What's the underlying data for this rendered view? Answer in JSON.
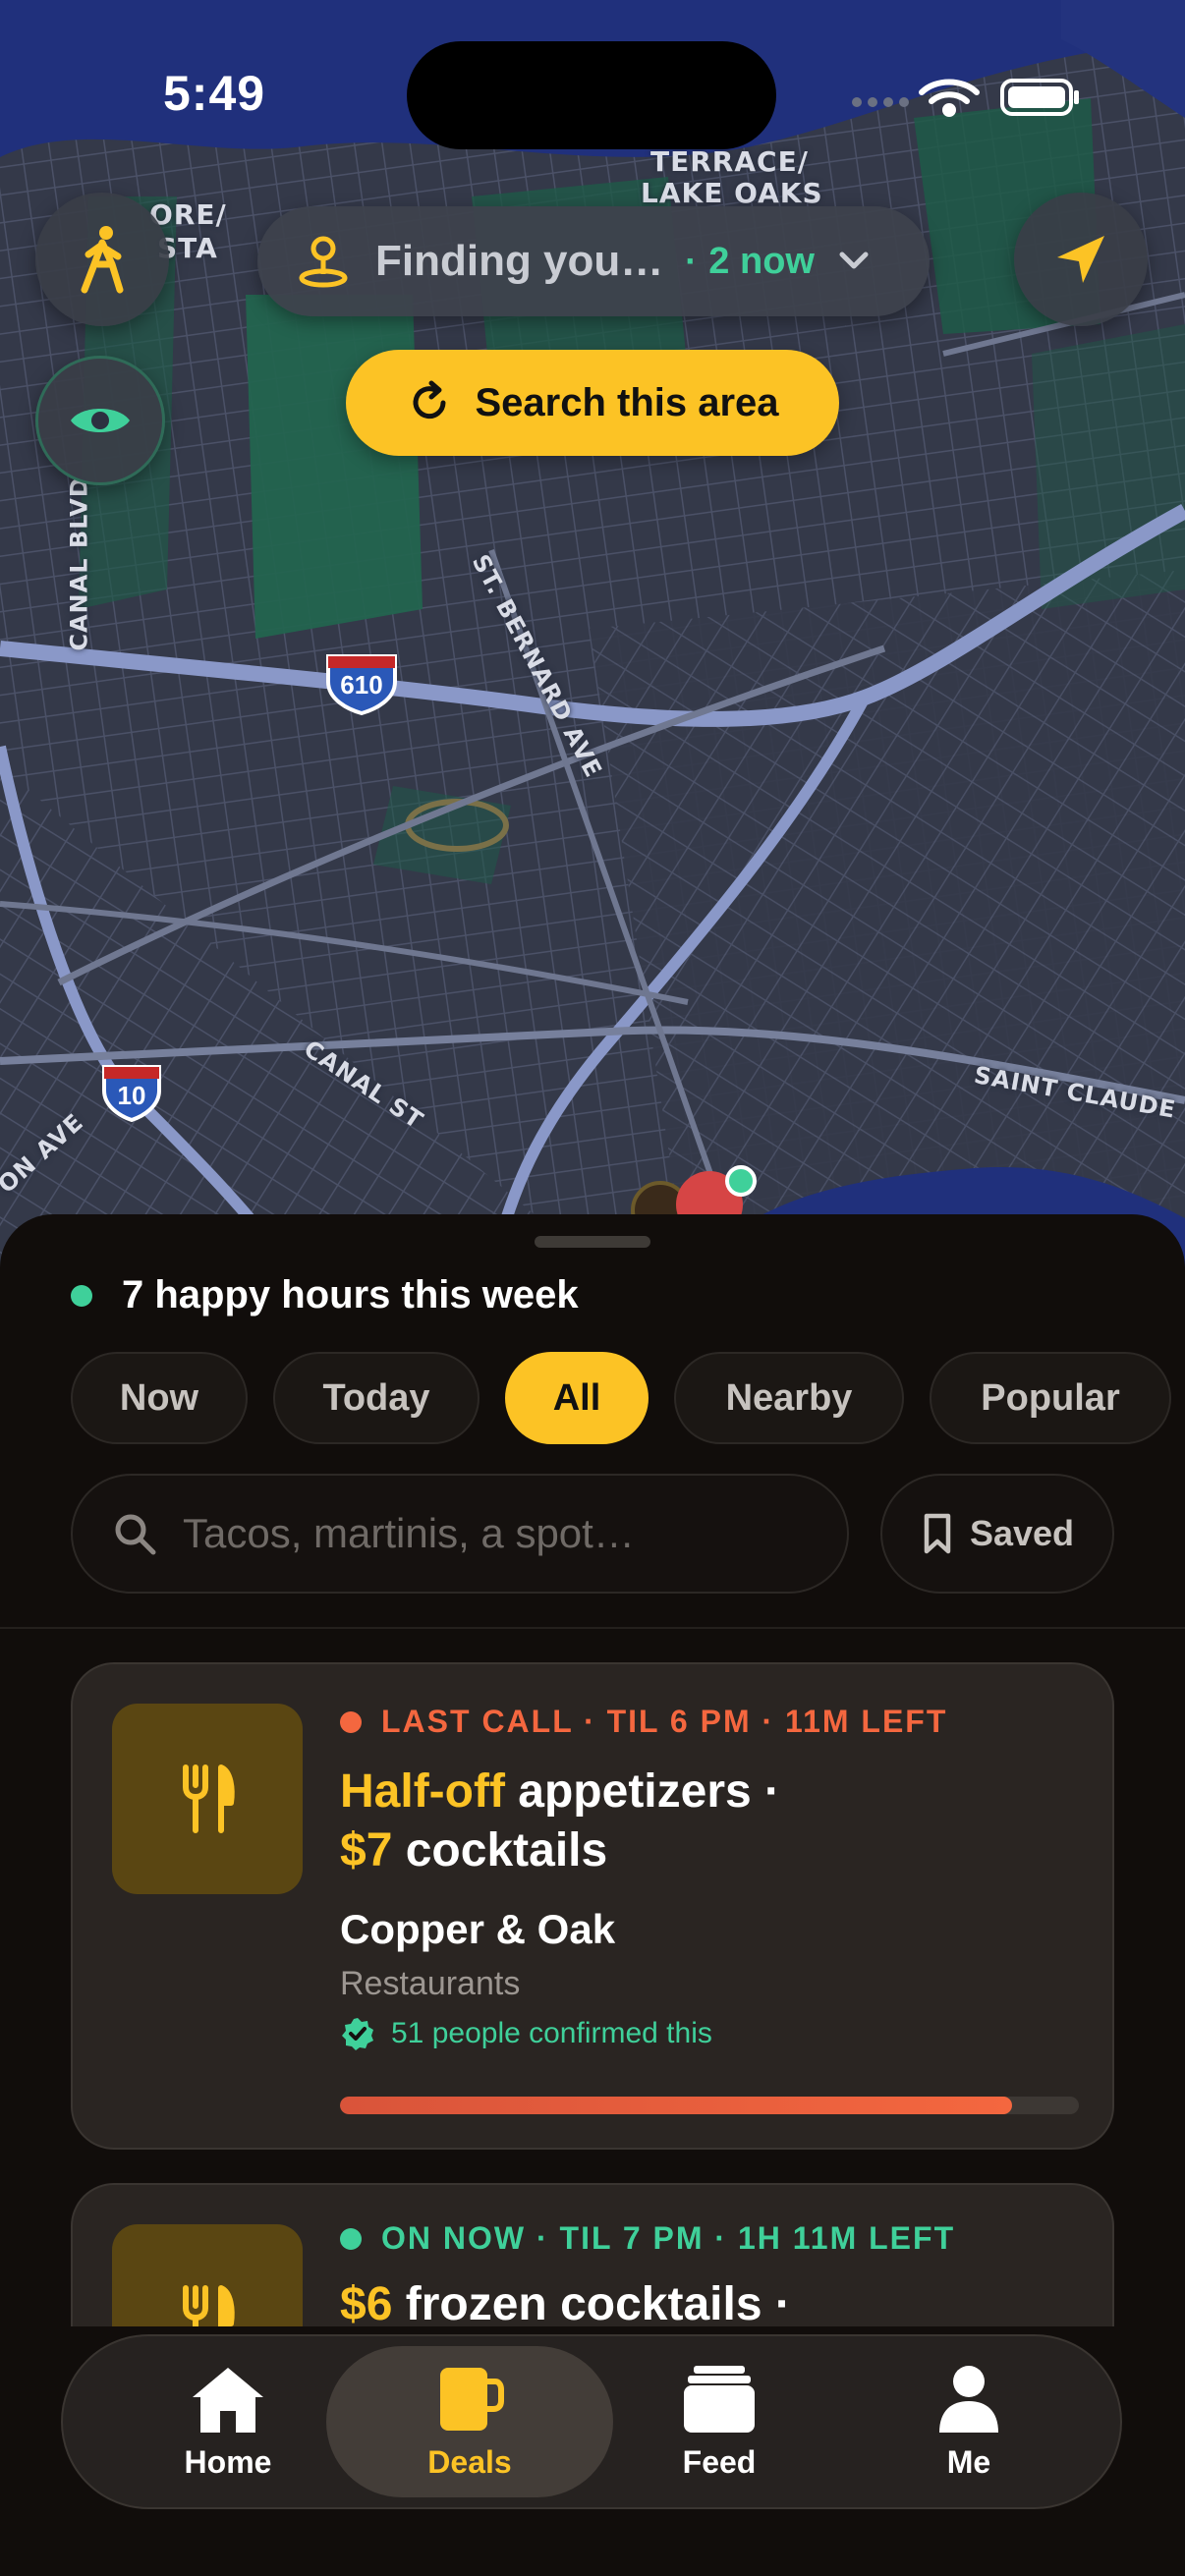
{
  "status_bar": {
    "time": "5:49"
  },
  "map": {
    "labels": {
      "terrace_1": "TERRACE/",
      "terrace_2": "LAKE OAKS",
      "ore_1": "ORE/",
      "ore_2": "STA",
      "canal_blvd": "CANAL BLVD",
      "st_bernard": "ST. BERNARD AVE",
      "canal_st": "CANAL ST",
      "saint_claude": "SAINT CLAUDE",
      "on_ave": "ON AVE"
    },
    "shields": {
      "i610": "610",
      "i10": "10"
    },
    "location_pill": {
      "label": "Finding you…",
      "separator": "·",
      "count": "2 now"
    },
    "search_area_label": "Search this area"
  },
  "sheet": {
    "summary": "7 happy hours this week",
    "filters": [
      "Now",
      "Today",
      "All",
      "Nearby",
      "Popular"
    ],
    "active_filter": "All",
    "search": {
      "placeholder": "Tacos, martinis, a spot…",
      "value": ""
    },
    "saved_label": "Saved",
    "deals": [
      {
        "status": "LAST CALL · TIL 6 PM · 11M LEFT",
        "status_color": "#f4673f",
        "deal_highlight_1": "Half-off",
        "deal_text_1": " appetizers ·",
        "deal_highlight_2": "$7",
        "deal_text_2": " cocktails",
        "venue": "Copper & Oak",
        "category": "Restaurants",
        "confirmed": "51 people confirmed this",
        "progress": 0.91,
        "icon": "fork-knife-icon"
      },
      {
        "status": "ON NOW · TIL 7 PM · 1H 11M LEFT",
        "status_color": "#3fd09a",
        "deal_highlight_1": "$6",
        "deal_text_1": " frozen cocktails ·",
        "icon": "fork-knife-icon"
      }
    ]
  },
  "tabbar": {
    "tabs": [
      {
        "label": "Home",
        "icon": "house-icon"
      },
      {
        "label": "Deals",
        "icon": "mug-icon"
      },
      {
        "label": "Feed",
        "icon": "stack-icon"
      },
      {
        "label": "Me",
        "icon": "person-icon"
      }
    ],
    "active": "Deals"
  },
  "colors": {
    "accent": "#fcc325",
    "green": "#3fd09a",
    "urgent": "#f4673f",
    "sheet_bg": "#110d0b",
    "card_bg": "#2a2522"
  }
}
